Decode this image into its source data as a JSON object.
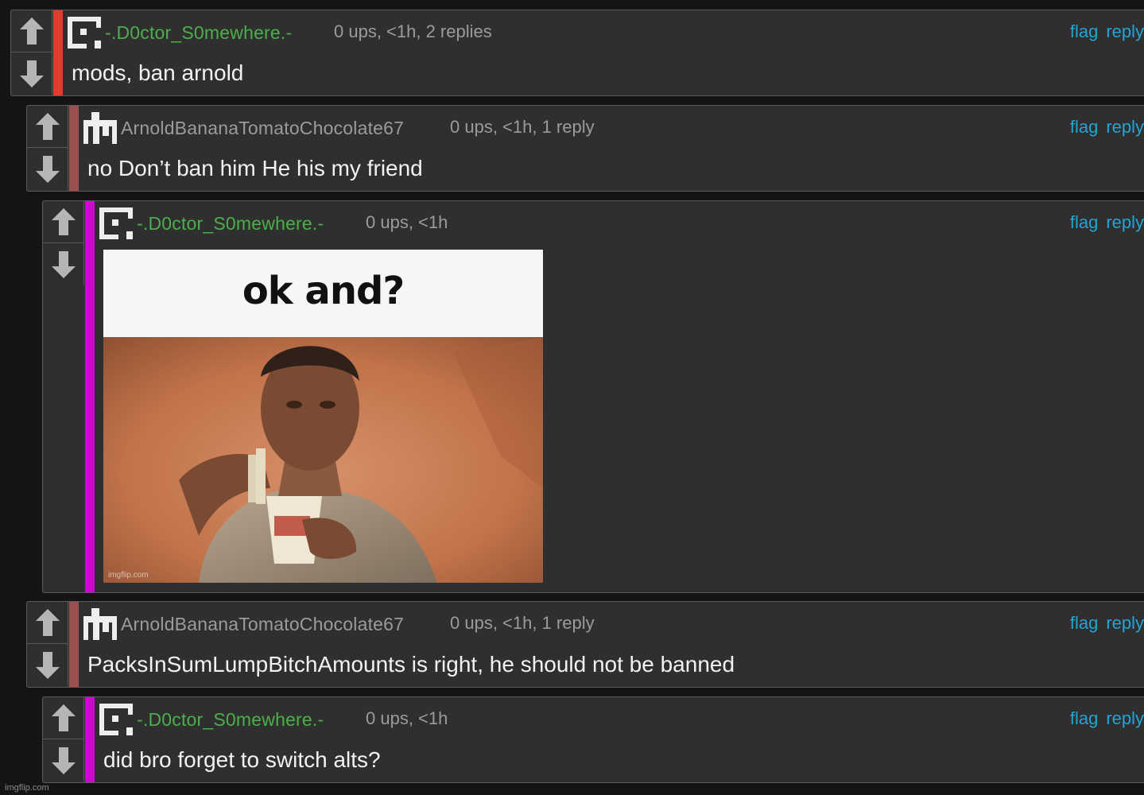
{
  "colors": {
    "link": "#23a4d6",
    "username_green": "#4cae4c",
    "username_gray": "#9b9b9b",
    "bar_red": "#e8392e",
    "bar_maroon": "#9a5050",
    "bar_magenta": "#d300d3"
  },
  "actions": {
    "flag": "flag",
    "reply": "reply"
  },
  "comments": [
    {
      "username": "-.D0ctor_S0mewhere.-",
      "meta": "0 ups, <1h, 2 replies",
      "text": "mods, ban arnold"
    },
    {
      "username": "ArnoldBananaTomatoChocolate67",
      "meta": "0 ups, <1h, 1 reply",
      "text": "no Don’t ban him He his my friend"
    },
    {
      "username": "-.D0ctor_S0mewhere.-",
      "meta": "0 ups, <1h",
      "image": {
        "caption": "ok and?",
        "watermark": "imgflip.com"
      }
    },
    {
      "username": "ArnoldBananaTomatoChocolate67",
      "meta": "0 ups, <1h, 1 reply",
      "text": "PacksInSumLumpBitchAmounts is right, he should not be banned"
    },
    {
      "username": "-.D0ctor_S0mewhere.-",
      "meta": "0 ups, <1h",
      "text": "did bro forget to switch alts?"
    }
  ],
  "page_watermark": "imgflip.com"
}
